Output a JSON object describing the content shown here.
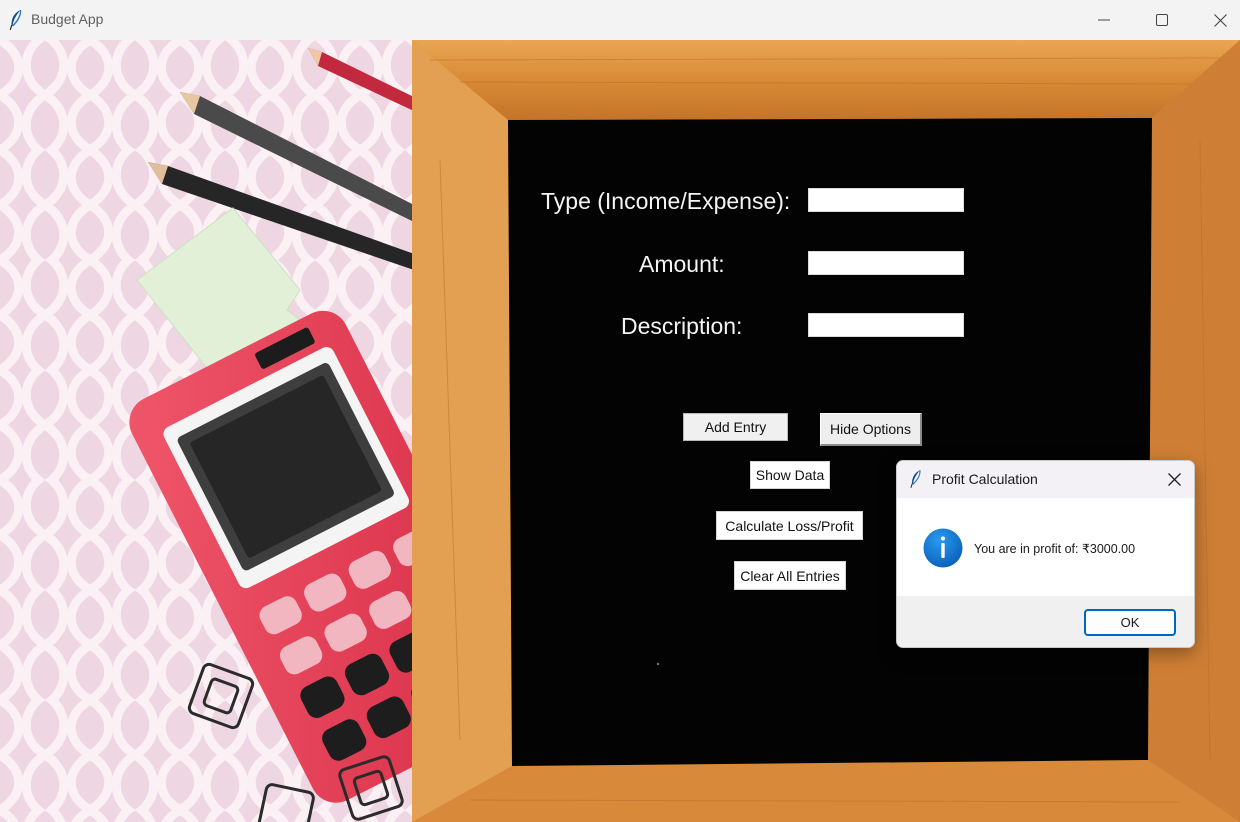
{
  "window": {
    "title": "Budget App",
    "minimize_icon": "minimize-icon",
    "maximize_icon": "maximize-icon",
    "close_icon": "close-icon"
  },
  "form": {
    "type_label": "Type (Income/Expense):",
    "type_value": "",
    "amount_label": "Amount:",
    "amount_value": "",
    "description_label": "Description:",
    "description_value": ""
  },
  "buttons": {
    "add_entry": "Add Entry",
    "hide_options": "Hide Options",
    "show_data": "Show Data",
    "calculate": "Calculate Loss/Profit",
    "clear_all": "Clear All Entries"
  },
  "dialog": {
    "title": "Profit Calculation",
    "message": "You are in profit of: ₹3000.00",
    "ok_label": "OK",
    "icon": "info-icon"
  },
  "colors": {
    "chalkboard": "#030303",
    "frame_wood": "#e39a46",
    "calculator_red": "#e23b52",
    "accent_blue": "#0067c0"
  }
}
